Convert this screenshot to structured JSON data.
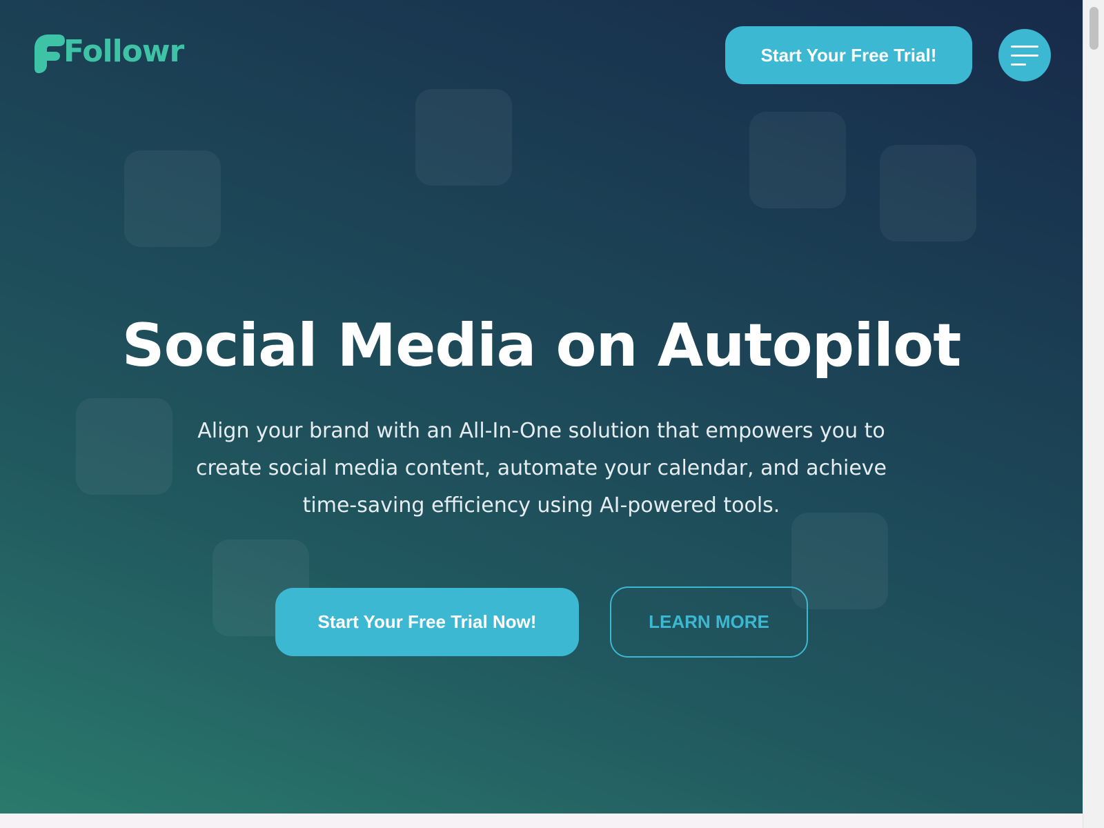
{
  "header": {
    "logo_text": "Followr",
    "cta_label": "Start Your Free Trial!",
    "menu_icon": "hamburger-menu-icon"
  },
  "hero": {
    "title": "Social Media on Autopilot",
    "subtitle": "Align your brand with an All-In-One solution that empowers you to create social media content, automate your calendar, and achieve time-saving efficiency using AI-powered tools.",
    "primary_cta": "Start Your Free Trial Now!",
    "secondary_cta": "LEARN MORE"
  },
  "colors": {
    "accent": "#3db8d2",
    "logo": "#3fc3a6",
    "gradient_start": "#2a7a6c",
    "gradient_end": "#172a4a",
    "text": "#ffffff"
  }
}
